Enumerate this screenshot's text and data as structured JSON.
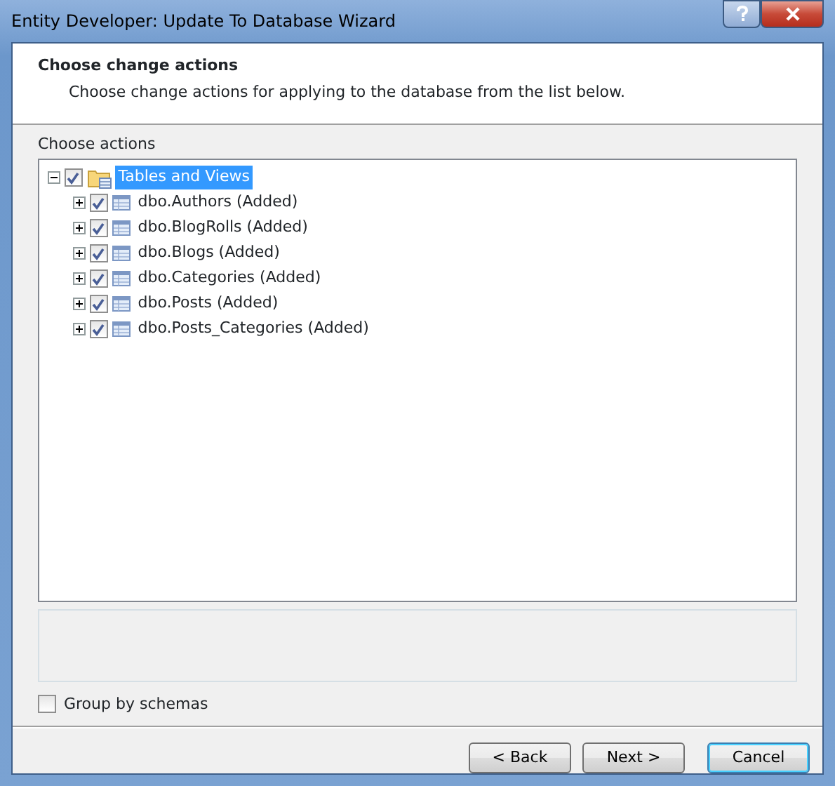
{
  "window": {
    "title": "Entity Developer: Update To Database Wizard"
  },
  "header": {
    "title": "Choose change actions",
    "subtitle": "Choose change actions for applying to the database from the list below."
  },
  "tree": {
    "label": "Choose actions",
    "nodes": [
      {
        "label": "Tables and Views",
        "kind": "folder",
        "expanded": true,
        "checked": true,
        "selected": true,
        "children": [
          {
            "label": "dbo.Authors (Added)",
            "kind": "table",
            "expanded": false,
            "checked": true,
            "selected": false
          },
          {
            "label": "dbo.BlogRolls (Added)",
            "kind": "table",
            "expanded": false,
            "checked": true,
            "selected": false
          },
          {
            "label": "dbo.Blogs (Added)",
            "kind": "table",
            "expanded": false,
            "checked": true,
            "selected": false
          },
          {
            "label": "dbo.Categories (Added)",
            "kind": "table",
            "expanded": false,
            "checked": true,
            "selected": false
          },
          {
            "label": "dbo.Posts (Added)",
            "kind": "table",
            "expanded": false,
            "checked": true,
            "selected": false
          },
          {
            "label": "dbo.Posts_Categories (Added)",
            "kind": "table",
            "expanded": false,
            "checked": true,
            "selected": false
          }
        ]
      }
    ]
  },
  "group_by_schemas": {
    "label": "Group by schemas",
    "checked": false
  },
  "buttons": [
    {
      "label": "< Back",
      "default": false
    },
    {
      "label": "Next >",
      "default": false
    },
    {
      "label": "Cancel",
      "default": true
    }
  ]
}
